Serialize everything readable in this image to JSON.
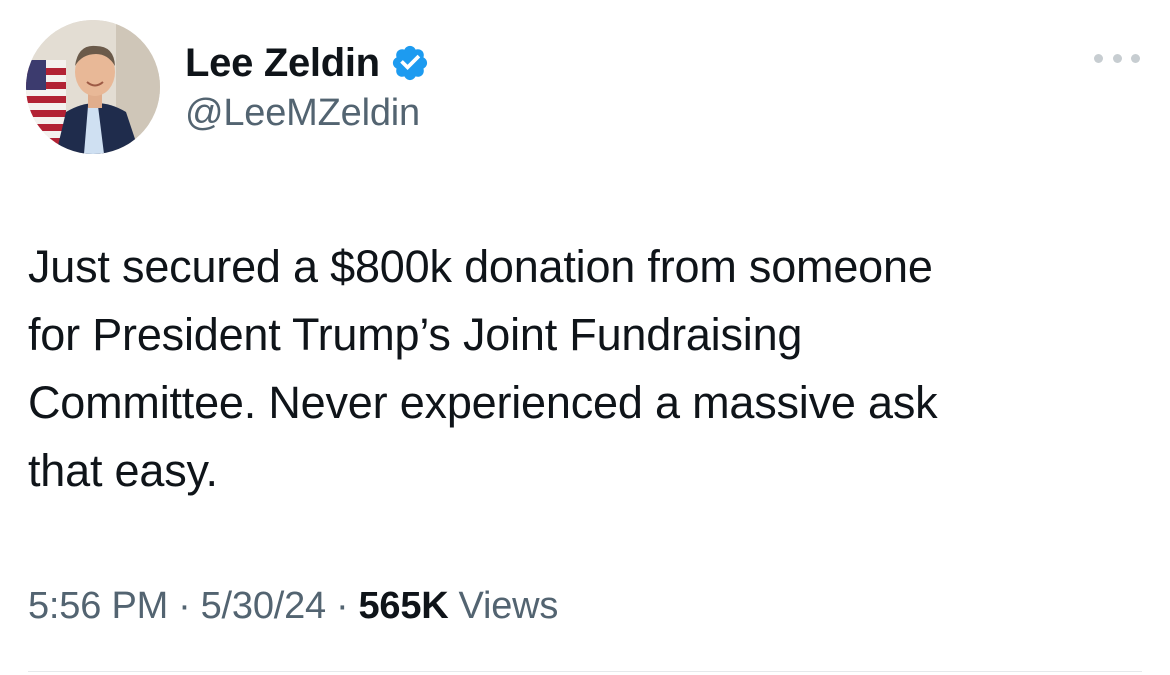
{
  "author": {
    "display_name": "Lee Zeldin",
    "handle": "@LeeMZeldin",
    "verified": true
  },
  "tweet": {
    "text": "Just secured a $800k donation from someone\nfor President Trump’s Joint Fundraising\nCommittee. Never experienced a massive ask\nthat easy.",
    "time": "5:56 PM",
    "date": "5/30/24",
    "views_count": "565K",
    "views_label": "Views",
    "separator": "·"
  },
  "icons": {
    "verified": "verified-badge-icon",
    "more": "more-options-icon"
  },
  "colors": {
    "verified_blue": "#1d9bf0",
    "text_primary": "#0f1419",
    "text_secondary": "#536471"
  }
}
